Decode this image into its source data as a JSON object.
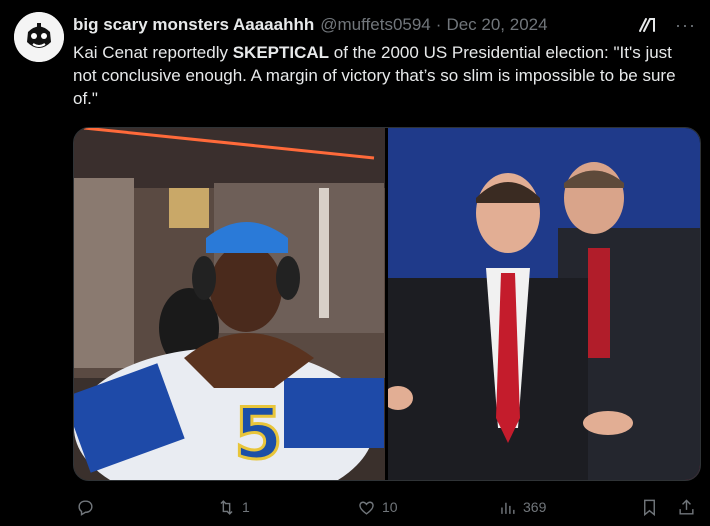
{
  "author": {
    "display_name": "big scary monsters Aaaaahhh",
    "handle": "@muffets0594",
    "separator": "·",
    "date": "Dec 20, 2024"
  },
  "tweet": {
    "text_part1": "Kai Cenat reportedly ",
    "text_bold": "SKEPTICAL",
    "text_part2": " of the 2000 US Presidential election: \"It's just not conclusive enough. A margin of victory that’s so slim is impossible to be sure of.\""
  },
  "media": {
    "left_jersey_number": "5"
  },
  "actions": {
    "replies": "",
    "retweets": "1",
    "likes": "10",
    "views": "369"
  },
  "colors": {
    "background": "#000000",
    "text": "#e7e9ea",
    "muted": "#71767b",
    "border": "#2f3336"
  },
  "icons": [
    "grok-icon",
    "more-icon",
    "reply-icon",
    "retweet-icon",
    "like-icon",
    "views-icon",
    "bookmark-icon",
    "share-icon"
  ]
}
